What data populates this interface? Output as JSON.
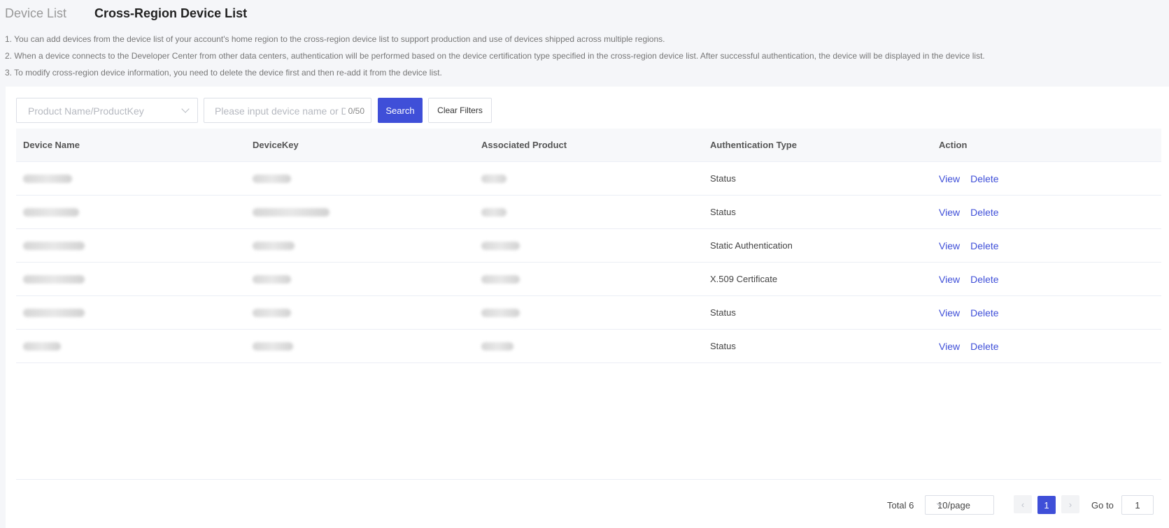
{
  "tabs": [
    {
      "label": "Device List"
    },
    {
      "label": "Cross-Region Device List"
    }
  ],
  "notes": [
    "1. You can add devices from the device list of your account's home region to the cross-region device list to support production and use of devices shipped across multiple regions.",
    "2. When a device connects to the Developer Center from other data centers, authentication will be performed based on the device certification type specified in the cross-region device list. After successful authentication, the device will be displayed in the device list.",
    "3. To modify cross-region device information, you need to delete the device first and then re-add it from the device list."
  ],
  "filters": {
    "product_placeholder": "Product Name/ProductKey",
    "device_placeholder": "Please input device name or DeviceKey",
    "counter": "0/50",
    "search_label": "Search",
    "clear_label": "Clear Filters"
  },
  "table": {
    "headers": [
      "Device Name",
      "DeviceKey",
      "Associated Product",
      "Authentication Type",
      "Action"
    ],
    "rows": [
      {
        "auth": "Status",
        "view": "View",
        "delete": "Delete"
      },
      {
        "auth": "Status",
        "view": "View",
        "delete": "Delete"
      },
      {
        "auth": "Static Authentication",
        "view": "View",
        "delete": "Delete"
      },
      {
        "auth": "X.509 Certificate",
        "view": "View",
        "delete": "Delete"
      },
      {
        "auth": "Status",
        "view": "View",
        "delete": "Delete"
      },
      {
        "auth": "Status",
        "view": "View",
        "delete": "Delete"
      }
    ]
  },
  "pagination": {
    "total": "Total 6",
    "page_size": "10/page",
    "prev": "‹",
    "current": "1",
    "next": "›",
    "goto_label": "Go to",
    "goto_value": "1"
  },
  "colors": {
    "accent": "#3f4fd8"
  }
}
